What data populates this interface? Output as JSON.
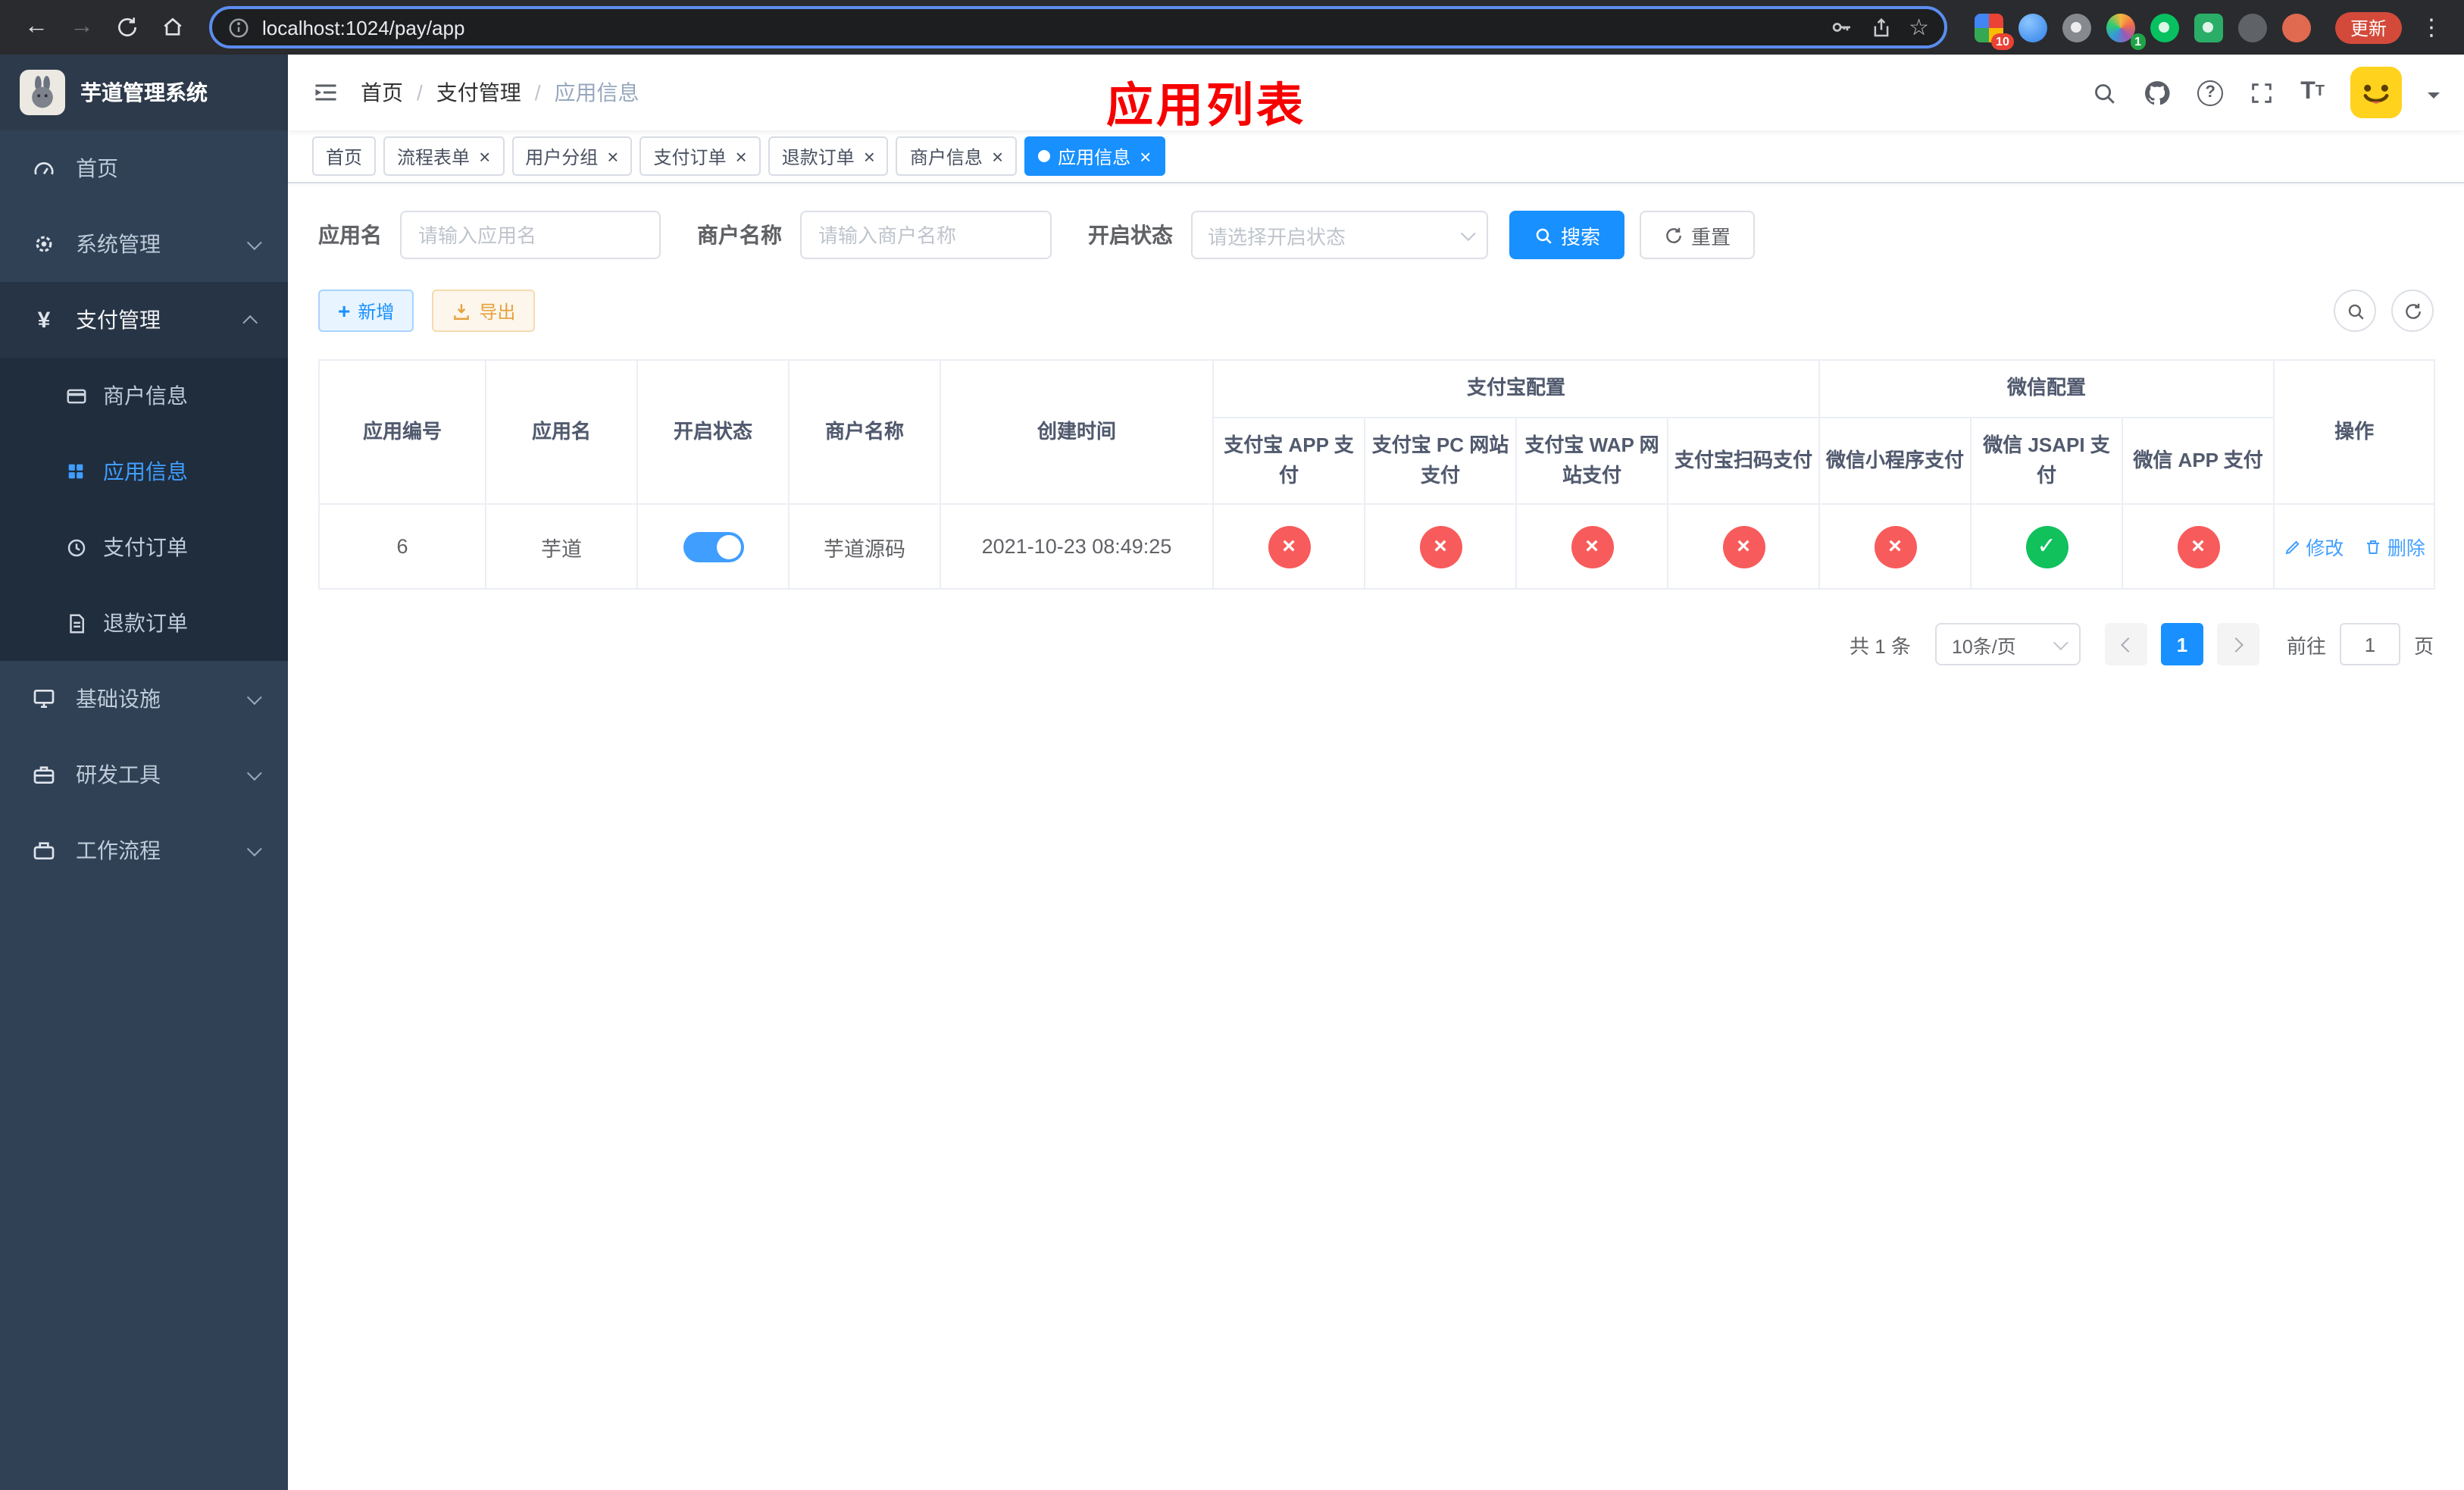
{
  "theme": {
    "primary": "#1890ff",
    "link": "#409eff",
    "danger": "#f85b5b",
    "success": "#10c15c",
    "warning": "#e6a23c",
    "sidebar_bg": "#304156",
    "submenu_bg": "#1f2d3d",
    "annotation_red": "#f70000"
  },
  "browser": {
    "url": "localhost:1024/pay/app",
    "update_label": "更新",
    "extension_badge_1": "10",
    "extension_badge_2": "1"
  },
  "sidebar": {
    "title": "芋道管理系统",
    "items": [
      {
        "label": "首页"
      },
      {
        "label": "系统管理"
      },
      {
        "label": "支付管理"
      },
      {
        "label": "基础设施"
      },
      {
        "label": "研发工具"
      },
      {
        "label": "工作流程"
      }
    ],
    "payment_children": [
      {
        "label": "商户信息"
      },
      {
        "label": "应用信息"
      },
      {
        "label": "支付订单"
      },
      {
        "label": "退款订单"
      }
    ]
  },
  "header": {
    "breadcrumb": [
      "首页",
      "支付管理",
      "应用信息"
    ],
    "annotation": "应用列表"
  },
  "tabs": [
    {
      "label": "首页"
    },
    {
      "label": "流程表单"
    },
    {
      "label": "用户分组"
    },
    {
      "label": "支付订单"
    },
    {
      "label": "退款订单"
    },
    {
      "label": "商户信息"
    },
    {
      "label": "应用信息"
    }
  ],
  "filters": {
    "app_name_label": "应用名",
    "app_name_placeholder": "请输入应用名",
    "merchant_label": "商户名称",
    "merchant_placeholder": "请输入商户名称",
    "status_label": "开启状态",
    "status_placeholder": "请选择开启状态",
    "search_label": "搜索",
    "reset_label": "重置"
  },
  "toolbar": {
    "add_label": "新增",
    "export_label": "导出"
  },
  "table": {
    "columns_left": [
      "应用编号",
      "应用名",
      "开启状态",
      "商户名称",
      "创建时间"
    ],
    "alipay_group": "支付宝配置",
    "alipay_columns": [
      "支付宝 APP 支付",
      "支付宝 PC 网站支付",
      "支付宝 WAP 网站支付",
      "支付宝扫码支付"
    ],
    "wechat_group": "微信配置",
    "wechat_columns": [
      "微信小程序支付",
      "微信 JSAPI 支付",
      "微信 APP 支付"
    ],
    "op_column": "操作",
    "rows": [
      {
        "id": "6",
        "name": "芋道",
        "enabled": true,
        "merchant": "芋道源码",
        "created": "2021-10-23 08:49:25",
        "alipay_app": "disabled",
        "alipay_pc": "disabled",
        "alipay_wap": "disabled",
        "alipay_qr": "disabled",
        "wechat_mini": "disabled",
        "wechat_jsapi": "enabled",
        "wechat_app": "disabled",
        "edit": "修改",
        "delete": "删除"
      }
    ]
  },
  "pagination": {
    "total": "共 1 条",
    "page_size": "10条/页",
    "page": "1",
    "goto_label": "前往",
    "goto_value": "1",
    "page_unit": "页"
  }
}
